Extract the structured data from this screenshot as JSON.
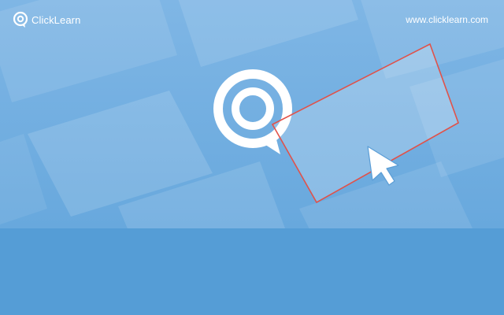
{
  "brand": {
    "name": "ClickLearn",
    "icon": "clicklearn-logo-icon"
  },
  "site_url": "www.clicklearn.com",
  "hero": {
    "logo_icon": "clicklearn-target-logo-icon",
    "cursor_icon": "mouse-pointer-icon",
    "selection_color": "#e0524a"
  },
  "colors": {
    "background_top": "#7fb4e3",
    "background_bottom": "#559dd6",
    "panel": "#8fbfe8",
    "accent": "#e0524a"
  }
}
